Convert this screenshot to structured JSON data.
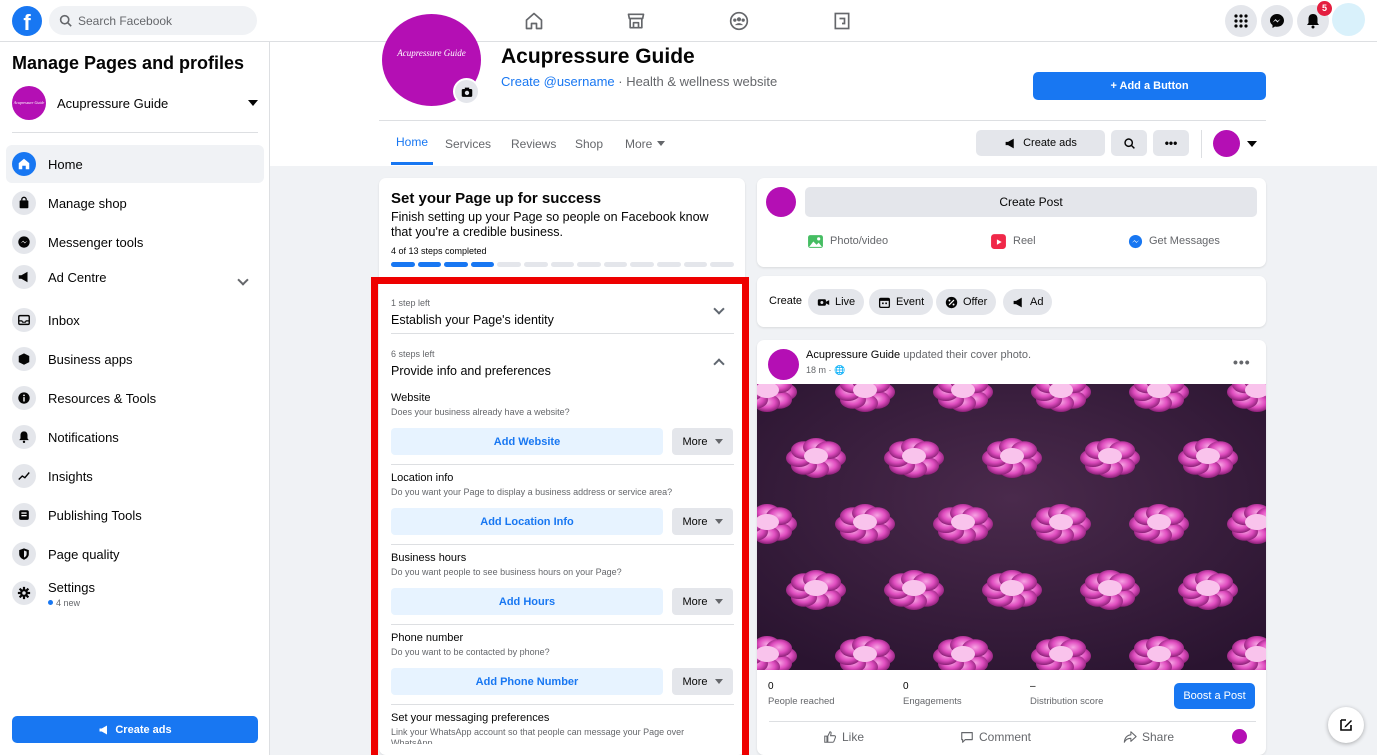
{
  "topbar": {
    "logo_letter": "f",
    "search_placeholder": "Search Facebook",
    "notification_count": "5"
  },
  "sidebar": {
    "title": "Manage Pages and profiles",
    "page_name": "Acupressure Guide",
    "page_avatar_text": "Acupressure Guide",
    "items": [
      {
        "label": "Home",
        "icon": "home-icon"
      },
      {
        "label": "Manage shop",
        "icon": "shopping-bag-icon"
      },
      {
        "label": "Messenger tools",
        "icon": "messenger-icon"
      },
      {
        "label": "Ad Centre",
        "icon": "megaphone-icon"
      },
      {
        "label": "Inbox",
        "icon": "inbox-icon"
      },
      {
        "label": "Business apps",
        "icon": "cube-icon"
      },
      {
        "label": "Resources & Tools",
        "icon": "info-icon"
      },
      {
        "label": "Notifications",
        "icon": "bell-icon"
      },
      {
        "label": "Insights",
        "icon": "insights-icon"
      },
      {
        "label": "Publishing Tools",
        "icon": "publishing-icon"
      },
      {
        "label": "Page quality",
        "icon": "shield-icon"
      },
      {
        "label": "Settings",
        "icon": "gear-icon"
      }
    ],
    "settings_sub": "4 new",
    "create_ads": "Create ads"
  },
  "header": {
    "cover_text": "Acupressure Guide",
    "page_name": "Acupressure Guide",
    "username_link": "Create @username",
    "category": " · Health & wellness website",
    "add_button": "+ Add a Button",
    "tabs": [
      "Home",
      "Services",
      "Reviews",
      "Shop",
      "More"
    ],
    "create_ads": "Create ads"
  },
  "setup": {
    "title": "Set your Page up for success",
    "desc": "Finish setting up your Page so people on Facebook know that you're a credible business.",
    "steps_done": "4 of 13 steps completed",
    "progress_completed": 4,
    "progress_total": 13,
    "section1_small": "1 step left",
    "section1_title": "Establish your Page's identity",
    "section2_small": "6 steps left",
    "section2_title": "Provide info and preferences",
    "items": [
      {
        "title": "Website",
        "desc": "Does your business already have a website?",
        "action": "Add Website",
        "more": "More"
      },
      {
        "title": "Location info",
        "desc": "Do you want your Page to display a business address or service area?",
        "action": "Add Location Info",
        "more": "More"
      },
      {
        "title": "Business hours",
        "desc": "Do you want people to see business hours on your Page?",
        "action": "Add Hours",
        "more": "More"
      },
      {
        "title": "Phone number",
        "desc": "Do you want to be contacted by phone?",
        "action": "Add Phone Number",
        "more": "More"
      }
    ],
    "msg_title": "Set your messaging preferences",
    "msg_desc": "Link your WhatsApp account so that people can message your Page over WhatsApp."
  },
  "composer": {
    "create_post": "Create Post",
    "actions": [
      "Photo/video",
      "Reel",
      "Get Messages"
    ],
    "create_label": "Create",
    "chips": [
      "Live",
      "Event",
      "Offer",
      "Ad"
    ]
  },
  "feed": {
    "author": "Acupressure Guide",
    "action_text": " updated their cover photo.",
    "time": "18 m · ",
    "stats": [
      {
        "num": "0",
        "label": "People reached"
      },
      {
        "num": "0",
        "label": "Engagements"
      },
      {
        "num": "–",
        "label": "Distribution score"
      }
    ],
    "boost": "Boost a Post",
    "reactions": [
      "Like",
      "Comment",
      "Share"
    ]
  },
  "colors": {
    "accent": "#1877f2",
    "page_brand": "#b40fb4",
    "highlight_frame": "#ee0000"
  }
}
